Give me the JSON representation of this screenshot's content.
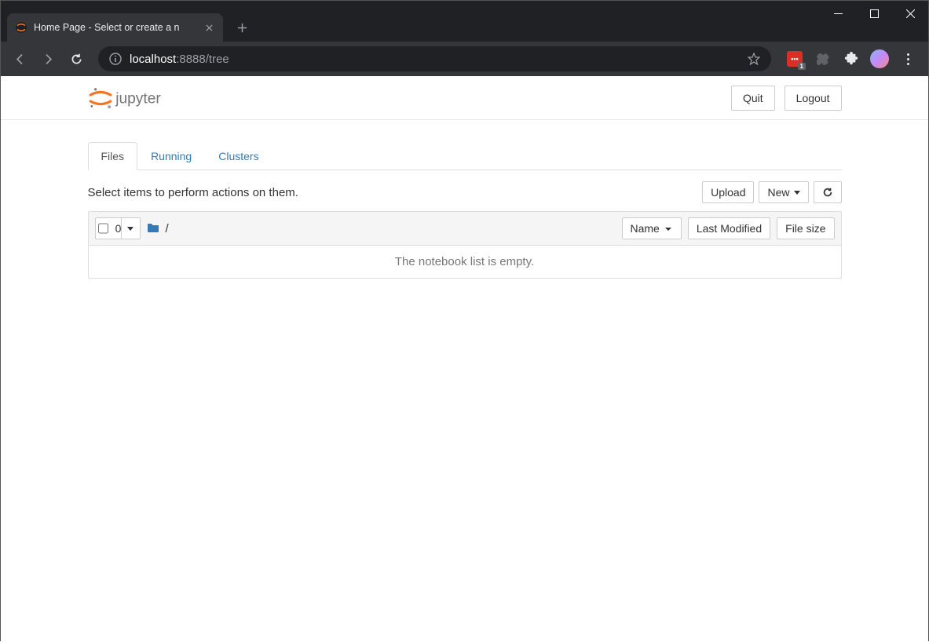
{
  "browser": {
    "tab_title": "Home Page - Select or create a n",
    "url_host": "localhost",
    "url_port_path": ":8888/tree",
    "ext_badge": "1"
  },
  "jupyter": {
    "logo_text": "jupyter",
    "quit_label": "Quit",
    "logout_label": "Logout",
    "tabs": {
      "files": "Files",
      "running": "Running",
      "clusters": "Clusters"
    },
    "action_hint": "Select items to perform actions on them.",
    "upload_label": "Upload",
    "new_label": "New",
    "select_count": "0",
    "breadcrumb_root": "/",
    "col_name": "Name",
    "col_modified": "Last Modified",
    "col_size": "File size",
    "empty_msg": "The notebook list is empty."
  }
}
